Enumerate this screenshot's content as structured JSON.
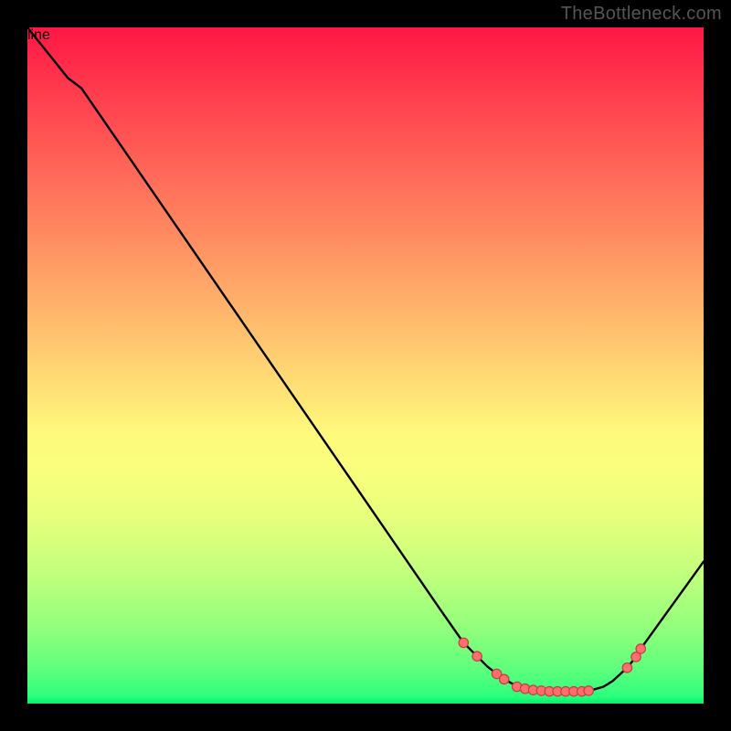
{
  "watermark": "TheBottleneck.com",
  "chart_data": {
    "type": "line",
    "title": "",
    "xlabel": "",
    "ylabel": "",
    "xlim": [
      0,
      100
    ],
    "ylim": [
      0,
      100
    ],
    "curve": [
      {
        "x": 0,
        "y": 100
      },
      {
        "x": 4,
        "y": 95
      },
      {
        "x": 6,
        "y": 92.5
      },
      {
        "x": 8,
        "y": 91
      },
      {
        "x": 61,
        "y": 14
      },
      {
        "x": 64.5,
        "y": 9
      },
      {
        "x": 66.5,
        "y": 7
      },
      {
        "x": 68,
        "y": 5.5
      },
      {
        "x": 69.4,
        "y": 4.4
      },
      {
        "x": 70.5,
        "y": 3.6
      },
      {
        "x": 72,
        "y": 2.8
      },
      {
        "x": 74,
        "y": 2.2
      },
      {
        "x": 76,
        "y": 1.8
      },
      {
        "x": 78,
        "y": 1.8
      },
      {
        "x": 80,
        "y": 1.8
      },
      {
        "x": 82,
        "y": 1.8
      },
      {
        "x": 83.5,
        "y": 2.0
      },
      {
        "x": 85.2,
        "y": 2.5
      },
      {
        "x": 86.5,
        "y": 3.3
      },
      {
        "x": 88.7,
        "y": 5.3
      },
      {
        "x": 90,
        "y": 6.9
      },
      {
        "x": 90.7,
        "y": 8.1
      },
      {
        "x": 100,
        "y": 21
      }
    ],
    "dots": [
      {
        "x": 64.5,
        "y": 9.0
      },
      {
        "x": 66.5,
        "y": 7.0
      },
      {
        "x": 69.4,
        "y": 4.4
      },
      {
        "x": 70.5,
        "y": 3.6
      },
      {
        "x": 72.4,
        "y": 2.5
      },
      {
        "x": 73.6,
        "y": 2.2
      },
      {
        "x": 74.8,
        "y": 2.0
      },
      {
        "x": 76.0,
        "y": 1.9
      },
      {
        "x": 77.2,
        "y": 1.8
      },
      {
        "x": 78.4,
        "y": 1.8
      },
      {
        "x": 79.6,
        "y": 1.8
      },
      {
        "x": 80.8,
        "y": 1.8
      },
      {
        "x": 82.0,
        "y": 1.8
      },
      {
        "x": 83.0,
        "y": 1.9
      },
      {
        "x": 88.7,
        "y": 5.3
      },
      {
        "x": 90.0,
        "y": 6.9
      },
      {
        "x": 90.7,
        "y": 8.1
      }
    ],
    "colors": {
      "curve": "#000000",
      "dots_fill": "#ff6f6f",
      "dots_stroke": "#cc3b3b"
    }
  }
}
